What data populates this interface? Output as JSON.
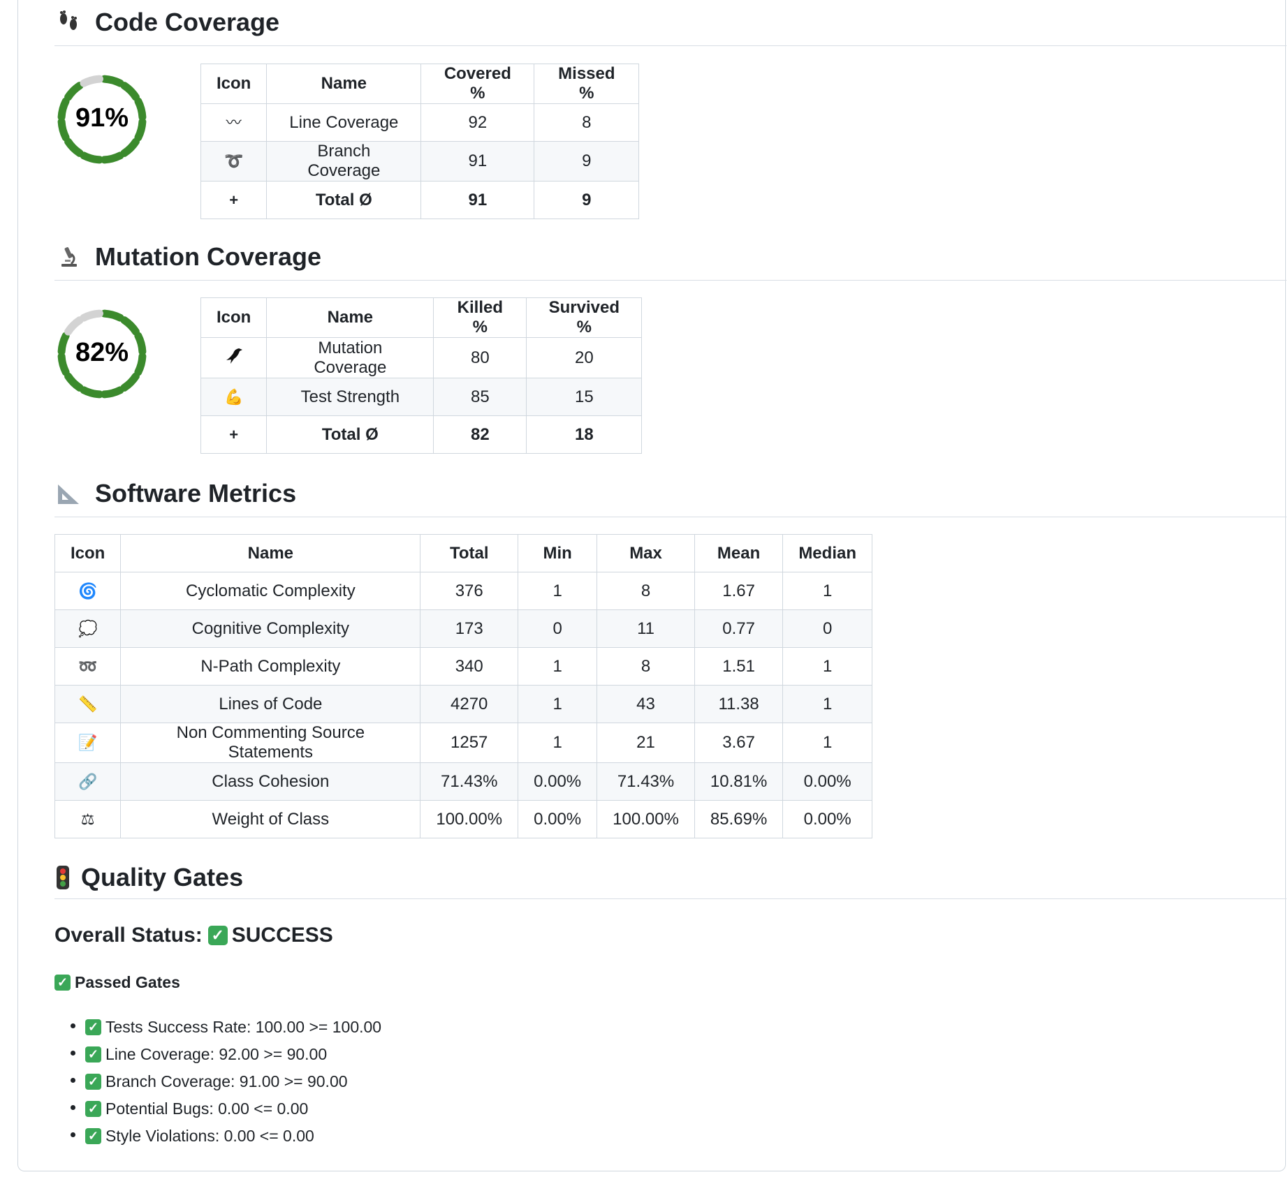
{
  "code_coverage": {
    "title": "Code Coverage",
    "title_icon": "footprints-icon",
    "percent_label": "91%",
    "percent_value": 91,
    "headers": [
      "Icon",
      "Name",
      "Covered %",
      "Missed %"
    ],
    "rows": [
      {
        "icon": "〰",
        "icon_name": "wavy-line-icon",
        "name": "Line Coverage",
        "a": "92",
        "b": "8"
      },
      {
        "icon": "➰",
        "icon_name": "curly-loop-icon",
        "name": "Branch Coverage",
        "a": "91",
        "b": "9"
      },
      {
        "icon": "➕",
        "icon_name": "plus-icon",
        "name": "Total Ø",
        "a": "91",
        "b": "9"
      }
    ]
  },
  "mutation_coverage": {
    "title": "Mutation Coverage",
    "title_icon": "microscope-icon",
    "percent_label": "82%",
    "percent_value": 82,
    "headers": [
      "Icon",
      "Name",
      "Killed %",
      "Survived %"
    ],
    "rows": [
      {
        "icon": "🐦",
        "icon_name": "bird-icon",
        "name": "Mutation Coverage",
        "a": "80",
        "b": "20"
      },
      {
        "icon": "💪",
        "icon_name": "flexed-biceps-icon",
        "name": "Test Strength",
        "a": "85",
        "b": "15"
      },
      {
        "icon": "➕",
        "icon_name": "plus-icon",
        "name": "Total Ø",
        "a": "82",
        "b": "18"
      }
    ]
  },
  "software_metrics": {
    "title": "Software Metrics",
    "title_icon": "triangular-ruler-icon",
    "headers": [
      "Icon",
      "Name",
      "Total",
      "Min",
      "Max",
      "Mean",
      "Median"
    ],
    "rows": [
      {
        "icon": "🌀",
        "icon_name": "cyclone-icon",
        "name": "Cyclomatic Complexity",
        "total": "376",
        "min": "1",
        "max": "8",
        "mean": "1.67",
        "median": "1"
      },
      {
        "icon": "💭",
        "icon_name": "thought-balloon-icon",
        "name": "Cognitive Complexity",
        "total": "173",
        "min": "0",
        "max": "11",
        "mean": "0.77",
        "median": "0"
      },
      {
        "icon": "➿",
        "icon_name": "double-loop-icon",
        "name": "N-Path Complexity",
        "total": "340",
        "min": "1",
        "max": "8",
        "mean": "1.51",
        "median": "1"
      },
      {
        "icon": "📏",
        "icon_name": "ruler-icon",
        "name": "Lines of Code",
        "total": "4270",
        "min": "1",
        "max": "43",
        "mean": "11.38",
        "median": "1"
      },
      {
        "icon": "📝",
        "icon_name": "memo-icon",
        "name": "Non Commenting Source Statements",
        "total": "1257",
        "min": "1",
        "max": "21",
        "mean": "3.67",
        "median": "1"
      },
      {
        "icon": "🔗",
        "icon_name": "link-icon",
        "name": "Class Cohesion",
        "total": "71.43%",
        "min": "0.00%",
        "max": "71.43%",
        "mean": "10.81%",
        "median": "0.00%"
      },
      {
        "icon": "⚖",
        "icon_name": "balance-scale-icon",
        "name": "Weight of Class",
        "total": "100.00%",
        "min": "0.00%",
        "max": "100.00%",
        "mean": "85.69%",
        "median": "0.00%"
      }
    ]
  },
  "quality_gates": {
    "title": "Quality Gates",
    "title_icon": "traffic-light-icon",
    "overall_prefix": "Overall Status:",
    "overall_value": "SUCCESS",
    "passed_heading": "Passed Gates",
    "gates": [
      "Tests Success Rate: 100.00 >= 100.00",
      "Line Coverage: 92.00 >= 90.00",
      "Branch Coverage: 91.00 >= 90.00",
      "Potential Bugs: 0.00 <= 0.00",
      "Style Violations: 0.00 <= 0.00"
    ]
  },
  "colors": {
    "donut_fill": "#3b8a2c",
    "donut_empty": "#d3d3d3",
    "check": "#3aa757"
  }
}
